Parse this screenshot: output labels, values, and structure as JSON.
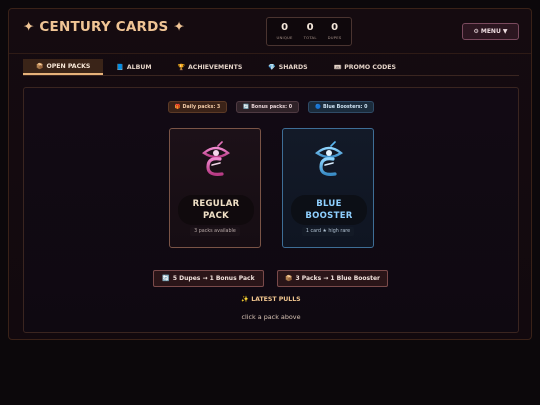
{
  "app": {
    "title": "✦ CENTURY CARDS ✦",
    "menu_icon": "⚙",
    "menu_label": "MENU ▼"
  },
  "stats": [
    {
      "value": "0",
      "label": "UNIQUE"
    },
    {
      "value": "0",
      "label": "TOTAL"
    },
    {
      "value": "0",
      "label": "DUPES"
    }
  ],
  "tabs": [
    {
      "icon": "📦",
      "icon_name": "package-icon",
      "label": "OPEN PACKS",
      "active": true
    },
    {
      "icon": "📘",
      "icon_name": "book-icon",
      "label": "ALBUM",
      "active": false
    },
    {
      "icon": "🏆",
      "icon_name": "trophy-icon",
      "label": "ACHIEVEMENTS",
      "active": false
    },
    {
      "icon": "💎",
      "icon_name": "gem-icon",
      "label": "SHARDS",
      "active": false
    },
    {
      "icon": "🎟",
      "icon_name": "ticket-icon",
      "label": "PROMO CODES",
      "active": false
    }
  ],
  "counters": {
    "daily": {
      "icon": "🎁",
      "text": "Daily packs: 3"
    },
    "bonus": {
      "icon": "🔄",
      "text": "Bonus packs: 0"
    },
    "blue": {
      "icon": "🔵",
      "text": "Blue Boosters: 0"
    }
  },
  "packs": {
    "regular": {
      "name": "REGULAR PACK",
      "sub": "3 packs available",
      "color": "#e06ab0"
    },
    "blue": {
      "name": "BLUE BOOSTER",
      "sub": "1 card ★ high rare",
      "color": "#5ab8f0"
    }
  },
  "exchanges": {
    "dupes": {
      "icon": "🔄",
      "label": "5 Dupes → 1 Bonus Pack"
    },
    "packs": {
      "icon": "📦",
      "label": "3 Packs → 1 Blue Booster"
    }
  },
  "latest": {
    "title": "✨ LATEST PULLS",
    "hint": "click a pack above"
  },
  "colors": {
    "accent": "#f0c595",
    "background": "#0c080b",
    "active_tab": "#e6b27a"
  }
}
